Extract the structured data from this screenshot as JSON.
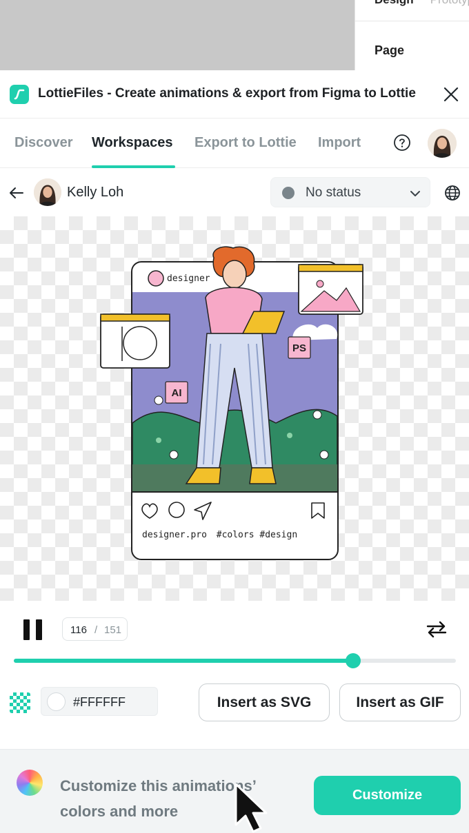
{
  "figma": {
    "right_panel_tabs": [
      "Design",
      "Prototype"
    ],
    "right_panel_section": "Page"
  },
  "plugin": {
    "title": "LottieFiles - Create animations & export from Figma to Lottie",
    "close_icon": "close-icon",
    "logo_icon": "lottiefiles-logo"
  },
  "nav": {
    "tabs": [
      {
        "label": "Discover",
        "active": false
      },
      {
        "label": "Workspaces",
        "active": true
      },
      {
        "label": "Export to Lottie",
        "active": false
      },
      {
        "label": "Import",
        "active": false
      }
    ],
    "help_icon": "help-circle-icon"
  },
  "user": {
    "name": "Kelly Loh",
    "status": "No status",
    "status_color": "#7a858b"
  },
  "preview": {
    "post_username": "designer.pro",
    "badge_ps": "PS",
    "badge_ai": "AI",
    "caption_user": "designer.pro",
    "caption_tags": "#colors #design"
  },
  "player": {
    "current_frame": "116",
    "separator": "/",
    "total_frames": "151",
    "progress": 0.7675,
    "state": "playing"
  },
  "background": {
    "hex": "#FFFFFF"
  },
  "actions": {
    "insert_svg": "Insert as SVG",
    "insert_gif": "Insert as GIF"
  },
  "customize": {
    "text": "Customize this animations’ colors and more",
    "button": "Customize"
  },
  "colors": {
    "accent": "#1fcfae",
    "text": "#20272c",
    "muted": "#8a9499"
  }
}
